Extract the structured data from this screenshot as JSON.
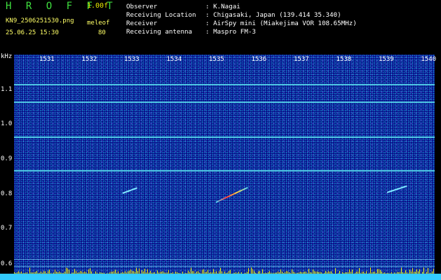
{
  "header": {
    "app_title": "H R O F F T",
    "version": "1.00f",
    "filename": "KN9_2506251530.png",
    "mode": "meleof",
    "datetime": "25.06.25 15:30",
    "count": "80",
    "observer_label": "Observer",
    "observer_value": ": K.Nagai",
    "location_label": "Receiving Location",
    "location_value": ": Chigasaki, Japan (139.414 35.340)",
    "receiver_label": "Receiver",
    "receiver_value": ": AirSpy mini (Miakejima VOR 108.65MHz)",
    "antenna_label": "Receiving antenna",
    "antenna_value": ": Maspro FM-3"
  },
  "plot": {
    "y_unit": "kHz",
    "y_ticks": [
      "1.1",
      "1.0",
      "0.9",
      "0.8",
      "0.7",
      "0.6"
    ],
    "x_ticks": [
      "1531",
      "1532",
      "1533",
      "1534",
      "1535",
      "1536",
      "1537",
      "1538",
      "1539",
      "1540"
    ],
    "background_color": "#0a0f8a",
    "trace_color": "#59e3f0",
    "bar_color": "#33ccff"
  }
}
